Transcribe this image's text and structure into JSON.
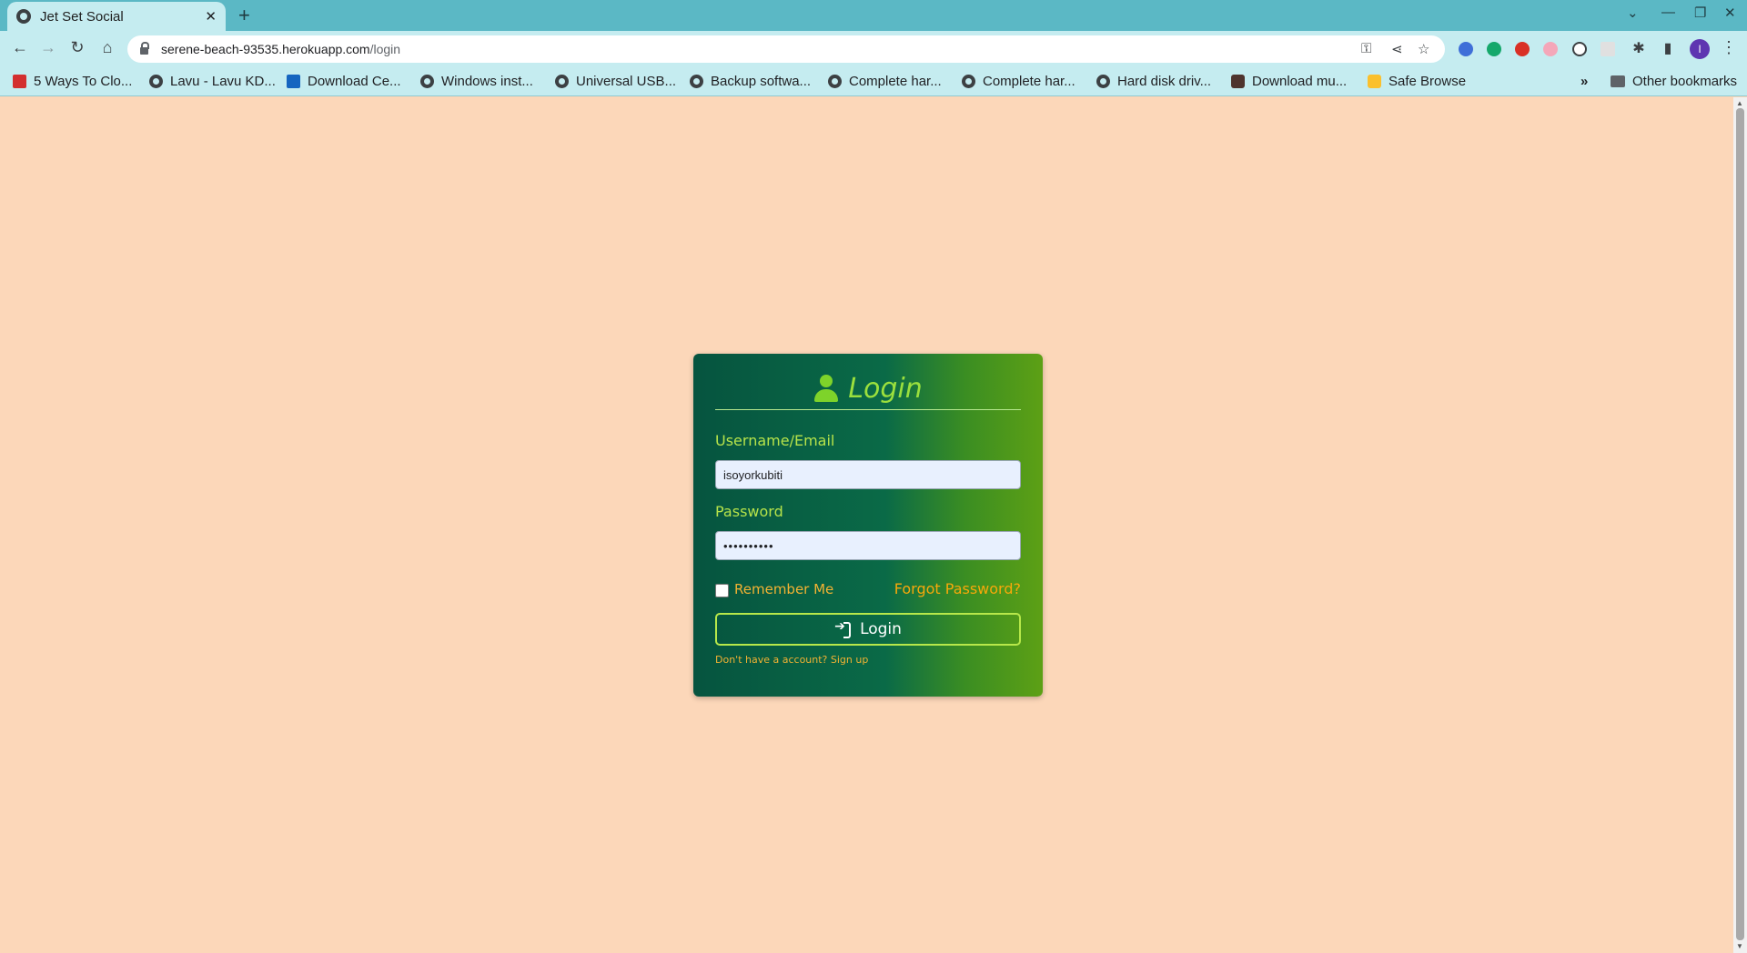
{
  "browser": {
    "tab_title": "Jet Set Social",
    "tab_close": "✕",
    "new_tab": "+",
    "url_host": "serene-beach-93535.herokuapp.com",
    "url_path": "/login",
    "avatar_letter": "I",
    "bookmarks": [
      {
        "label": "5 Ways To Clo...",
        "icon": "red-book-icon"
      },
      {
        "label": "Lavu - Lavu KD...",
        "icon": "globe-icon"
      },
      {
        "label": "Download Ce...",
        "icon": "blue-site-icon"
      },
      {
        "label": "Windows inst...",
        "icon": "globe-icon"
      },
      {
        "label": "Universal USB...",
        "icon": "globe-icon"
      },
      {
        "label": "Backup softwa...",
        "icon": "globe-icon"
      },
      {
        "label": "Complete har...",
        "icon": "globe-icon"
      },
      {
        "label": "Complete har...",
        "icon": "globe-icon"
      },
      {
        "label": "Hard disk driv...",
        "icon": "globe-icon"
      },
      {
        "label": "Download mu...",
        "icon": "download-site-icon"
      },
      {
        "label": "Safe Browse",
        "icon": "lock-site-icon"
      }
    ],
    "bookmarks_overflow": "»",
    "other_bookmarks": "Other bookmarks"
  },
  "login": {
    "title": "Login",
    "username_label": "Username/Email",
    "username_value": "isoyorkubiti",
    "password_label": "Password",
    "password_value": "••••••••••",
    "remember_label": "Remember Me",
    "remember_checked": false,
    "forgot_link": "Forgot Password?",
    "login_button": "Login",
    "signup_text": "Don't have a account? Sign up"
  },
  "colors": {
    "page_bg": "#fcd7b9",
    "card_gradient_start": "#06543f",
    "card_gradient_end": "#5da015",
    "title_color": "#9be03d",
    "link_color": "#f7a80a"
  }
}
